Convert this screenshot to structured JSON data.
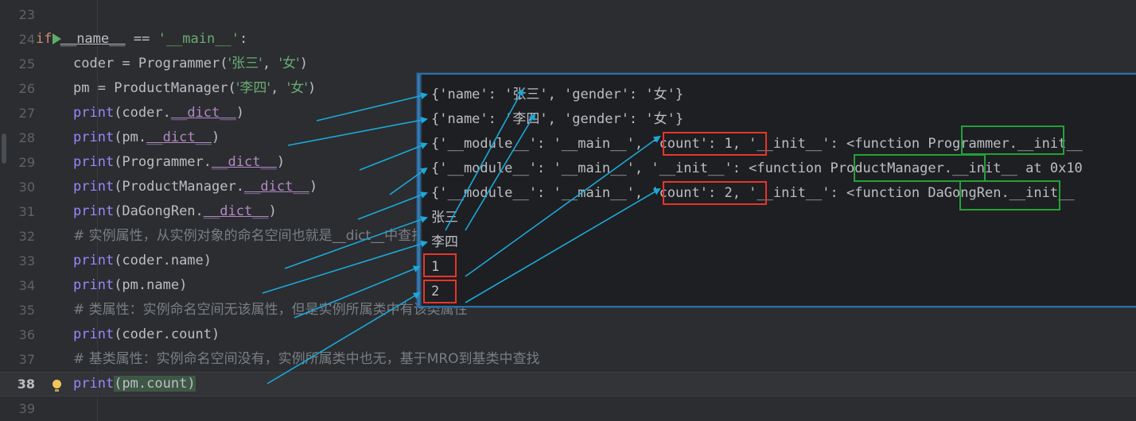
{
  "editor": {
    "language": "python",
    "theme_bg": "#2b2d30",
    "lines": [
      {
        "no": "23",
        "indent": 0,
        "gutter": "",
        "tokens": []
      },
      {
        "no": "24",
        "indent": 0,
        "gutter": "run-icon",
        "tokens": [
          {
            "t": "if ",
            "c": "t-kw"
          },
          {
            "t": "__name__",
            "c": "t-dunder"
          },
          {
            "t": " == ",
            "c": "t-plain"
          },
          {
            "t": "'",
            "c": "t-str"
          },
          {
            "t": "__main__",
            "c": "t-str"
          },
          {
            "t": "'",
            "c": "t-str"
          },
          {
            "t": ":",
            "c": "t-plain"
          }
        ]
      },
      {
        "no": "25",
        "indent": 1,
        "gutter": "",
        "tokens": [
          {
            "t": "coder = ",
            "c": "t-plain"
          },
          {
            "t": "Programmer",
            "c": "t-cls"
          },
          {
            "t": "(",
            "c": "t-plain"
          },
          {
            "t": "'张三'",
            "c": "t-str"
          },
          {
            "t": ", ",
            "c": "t-plain"
          },
          {
            "t": "'女'",
            "c": "t-str"
          },
          {
            "t": ")",
            "c": "t-plain"
          }
        ]
      },
      {
        "no": "26",
        "indent": 1,
        "gutter": "",
        "tokens": [
          {
            "t": "pm = ",
            "c": "t-plain"
          },
          {
            "t": "ProductManager",
            "c": "t-cls"
          },
          {
            "t": "(",
            "c": "t-plain"
          },
          {
            "t": "'李四'",
            "c": "t-str"
          },
          {
            "t": ", ",
            "c": "t-plain"
          },
          {
            "t": "'女'",
            "c": "t-str"
          },
          {
            "t": ")",
            "c": "t-plain"
          }
        ]
      },
      {
        "no": "27",
        "indent": 1,
        "gutter": "",
        "tokens": [
          {
            "t": "print",
            "c": "t-fn"
          },
          {
            "t": "(coder.",
            "c": "t-plain"
          },
          {
            "t": "__dict__",
            "c": "t-magic"
          },
          {
            "t": ")",
            "c": "t-plain"
          }
        ]
      },
      {
        "no": "28",
        "indent": 1,
        "gutter": "",
        "tokens": [
          {
            "t": "print",
            "c": "t-fn"
          },
          {
            "t": "(pm.",
            "c": "t-plain"
          },
          {
            "t": "__dict__",
            "c": "t-magic"
          },
          {
            "t": ")",
            "c": "t-plain"
          }
        ]
      },
      {
        "no": "29",
        "indent": 1,
        "gutter": "",
        "tokens": [
          {
            "t": "print",
            "c": "t-fn"
          },
          {
            "t": "(Programmer.",
            "c": "t-plain"
          },
          {
            "t": "__dict__",
            "c": "t-magic"
          },
          {
            "t": ")",
            "c": "t-plain"
          }
        ]
      },
      {
        "no": "30",
        "indent": 1,
        "gutter": "",
        "tokens": [
          {
            "t": "print",
            "c": "t-fn"
          },
          {
            "t": "(ProductManager.",
            "c": "t-plain"
          },
          {
            "t": "__dict__",
            "c": "t-magic"
          },
          {
            "t": ")",
            "c": "t-plain"
          }
        ]
      },
      {
        "no": "31",
        "indent": 1,
        "gutter": "",
        "tokens": [
          {
            "t": "print",
            "c": "t-fn"
          },
          {
            "t": "(DaGongRen.",
            "c": "t-plain"
          },
          {
            "t": "__dict__",
            "c": "t-magic"
          },
          {
            "t": ")",
            "c": "t-plain"
          }
        ]
      },
      {
        "no": "32",
        "indent": 1,
        "gutter": "",
        "tokens": [
          {
            "t": "# 实例属性，从实例对象的命名空间也就是__dict__中查找",
            "c": "t-comment"
          }
        ]
      },
      {
        "no": "33",
        "indent": 1,
        "gutter": "",
        "tokens": [
          {
            "t": "print",
            "c": "t-fn"
          },
          {
            "t": "(coder.name)",
            "c": "t-plain"
          }
        ]
      },
      {
        "no": "34",
        "indent": 1,
        "gutter": "",
        "tokens": [
          {
            "t": "print",
            "c": "t-fn"
          },
          {
            "t": "(pm.name)",
            "c": "t-plain"
          }
        ]
      },
      {
        "no": "35",
        "indent": 1,
        "gutter": "",
        "tokens": [
          {
            "t": "# 类属性：实例命名空间无该属性，但是实例所属类中有该类属性",
            "c": "t-comment"
          }
        ]
      },
      {
        "no": "36",
        "indent": 1,
        "gutter": "",
        "tokens": [
          {
            "t": "print",
            "c": "t-fn"
          },
          {
            "t": "(coder.count)",
            "c": "t-plain"
          }
        ]
      },
      {
        "no": "37",
        "indent": 1,
        "gutter": "",
        "tokens": [
          {
            "t": "# 基类属性：实例命名空间没有，实例所属类中也无，基于MRO到基类中查找",
            "c": "t-comment"
          }
        ]
      },
      {
        "no": "38",
        "indent": 1,
        "gutter": "bulb-icon",
        "current": true,
        "tokens": [
          {
            "t": "print",
            "c": "t-fn"
          },
          {
            "t": "(",
            "c": "t-plain hl-green"
          },
          {
            "t": "pm.count",
            "c": "t-plain hl-green"
          },
          {
            "t": ")",
            "c": "t-plain hl-green"
          }
        ]
      },
      {
        "no": "39",
        "indent": 0,
        "gutter": "",
        "tokens": []
      }
    ]
  },
  "output_panel": {
    "border_color": "#2d6ea8",
    "background": "#1e1f22",
    "lines": [
      {
        "text": "{'name': '张三', 'gender': '女'}"
      },
      {
        "text": "{'name': '李四', 'gender': '女'}"
      },
      {
        "text": "{'__module__': '__main__', 'count': 1, '__init__': <function Programmer.__init__"
      },
      {
        "text": "{'__module__': '__main__', '__init__': <function ProductManager.__init__ at 0x10"
      },
      {
        "text": "{'__module__': '__main__', 'count': 2, '__init__': <function DaGongRen.__init__"
      },
      {
        "text": "张三"
      },
      {
        "text": "李四"
      },
      {
        "text": "1"
      },
      {
        "text": "2"
      }
    ]
  },
  "annotations": {
    "arrow_color": "#1ca8d8",
    "red_box_color": "#e8352a",
    "green_box_color": "#23a138",
    "red_highlights": [
      {
        "label": "'count': 1,"
      },
      {
        "label": "'count': 2,"
      },
      {
        "label": "1"
      },
      {
        "label": "2"
      }
    ],
    "green_highlights": [
      {
        "label": "Programmer."
      },
      {
        "label": "ProductManager"
      },
      {
        "label": "DaGongRen."
      }
    ],
    "arrow_pairs": [
      {
        "from": "print(coder.__dict__)",
        "to": "{'name': '张三', 'gender': '女'}"
      },
      {
        "from": "print(pm.__dict__)",
        "to": "{'name': '李四', 'gender': '女'}"
      },
      {
        "from": "print(Programmer.__dict__)",
        "to": "{'__module__': '__main__', 'count': 1, ..."
      },
      {
        "from": "print(ProductManager.__dict__)",
        "to": "{'__module__': '__main__', '__init__': ..."
      },
      {
        "from": "print(DaGongRen.__dict__)",
        "to": "{'__module__': '__main__', 'count': 2, ..."
      },
      {
        "from": "print(coder.name)",
        "to": "张三"
      },
      {
        "from": "print(pm.name)",
        "to": "李四"
      },
      {
        "from": "print(coder.count)",
        "to": "'count': 1,"
      },
      {
        "from": "print(pm.count)",
        "to": "'count': 2,"
      }
    ]
  }
}
